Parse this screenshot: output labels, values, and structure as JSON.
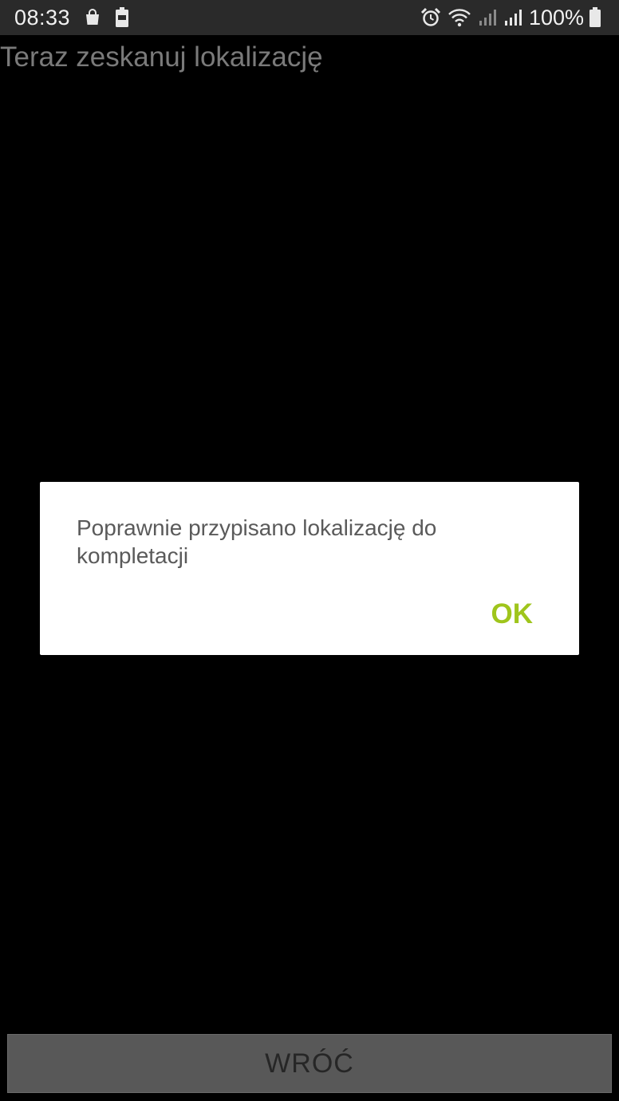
{
  "status_bar": {
    "time": "08:33",
    "battery_percent": "100%",
    "left_icons": [
      "shopping-bag-icon",
      "battery-saver-icon"
    ],
    "right_icons": [
      "alarm-icon",
      "wifi-icon",
      "signal-icon",
      "battery-icon"
    ]
  },
  "screen": {
    "title": "Teraz zeskanuj lokalizację"
  },
  "dialog": {
    "message": "Poprawnie przypisano lokalizację do kompletacji",
    "ok_label": "OK",
    "ok_color": "#9fc51c"
  },
  "footer": {
    "back_label": "WRÓĆ"
  }
}
